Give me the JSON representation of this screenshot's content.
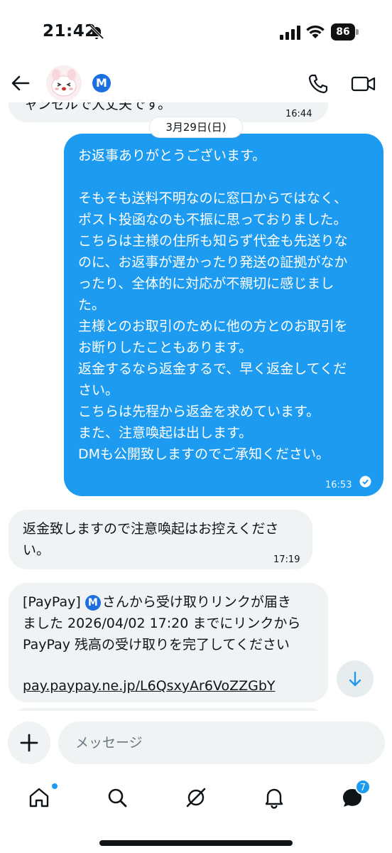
{
  "status_bar": {
    "time": "21:42",
    "battery": "86"
  },
  "header": {
    "badge_letter": "M"
  },
  "date_separator": "3月29日(日)",
  "messages": [
    {
      "direction": "in",
      "text": "ャンセルで大丈夫です。",
      "time": "16:44"
    },
    {
      "direction": "out",
      "text": "お返事ありがとうございます。\n\nそもそも送料不明なのに窓口からではなく、\nポスト投函なのも不振に思っておりました。\nこちらは主様の住所も知らず代金も先送りな\nのに、お返事が遅かったり発送の証拠がなか\nったり、全体的に対応が不親切に感じまし\nた。\n主様とのお取引のために他の方とのお取引を\nお断りしたこともあります。\n返金するなら返金するで、早く返金してくだ\nさい。\nこちらは先程から返金を求めています。\nまた、注意喚起は出します。\nDMも公開致しますのでご承知ください。",
      "time": "16:53"
    },
    {
      "direction": "in",
      "text": "返金致しますので注意喚起はお控えくださ\nい。",
      "time": "17:19"
    },
    {
      "direction": "in",
      "text_prefix": "[PayPay] ",
      "badge_letter": "M",
      "text": "さんから受け取りリンクが届き\nました 2026/04/02 17:20 までにリンクから\nPayPay 残高の受け取りを完了してください",
      "link": "pay.paypay.ne.jp/L6QsxyAr6VoZZGbY"
    }
  ],
  "composer": {
    "placeholder": "メッセージ"
  },
  "tab_bar": {
    "dm_badge_count": "7"
  },
  "colors": {
    "accent": "#1d9bf0",
    "incoming_bubble": "#eff3f4",
    "text": "#0f1419"
  }
}
